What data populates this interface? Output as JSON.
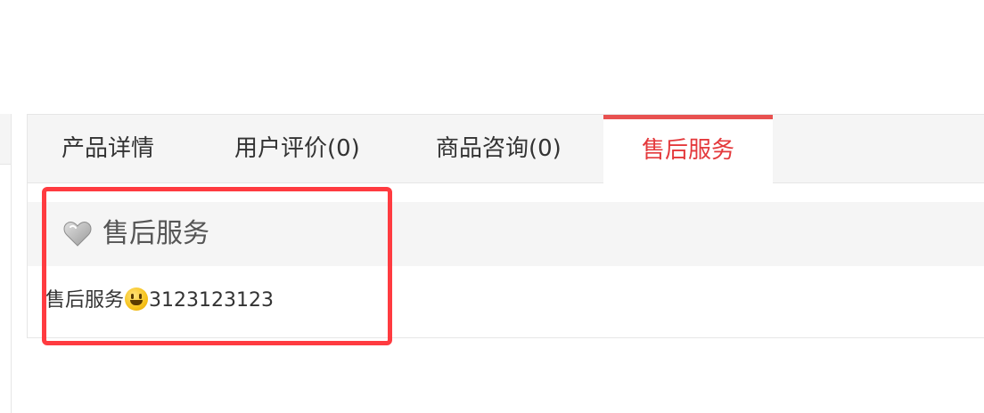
{
  "tabs": [
    {
      "label": "产品详情",
      "active": false
    },
    {
      "label": "用户评价(0)",
      "active": false
    },
    {
      "label": "商品咨询(0)",
      "active": false
    },
    {
      "label": "售后服务",
      "active": true
    }
  ],
  "section": {
    "icon": "heart-icon",
    "title": "售后服务"
  },
  "content": {
    "prefix": "售后服务",
    "emoji_icon": "smile-icon",
    "suffix": "3123123123"
  },
  "colors": {
    "accent": "#e4393c",
    "tab_bar_bg": "#f5f5f5",
    "highlight": "#ff3b40"
  }
}
